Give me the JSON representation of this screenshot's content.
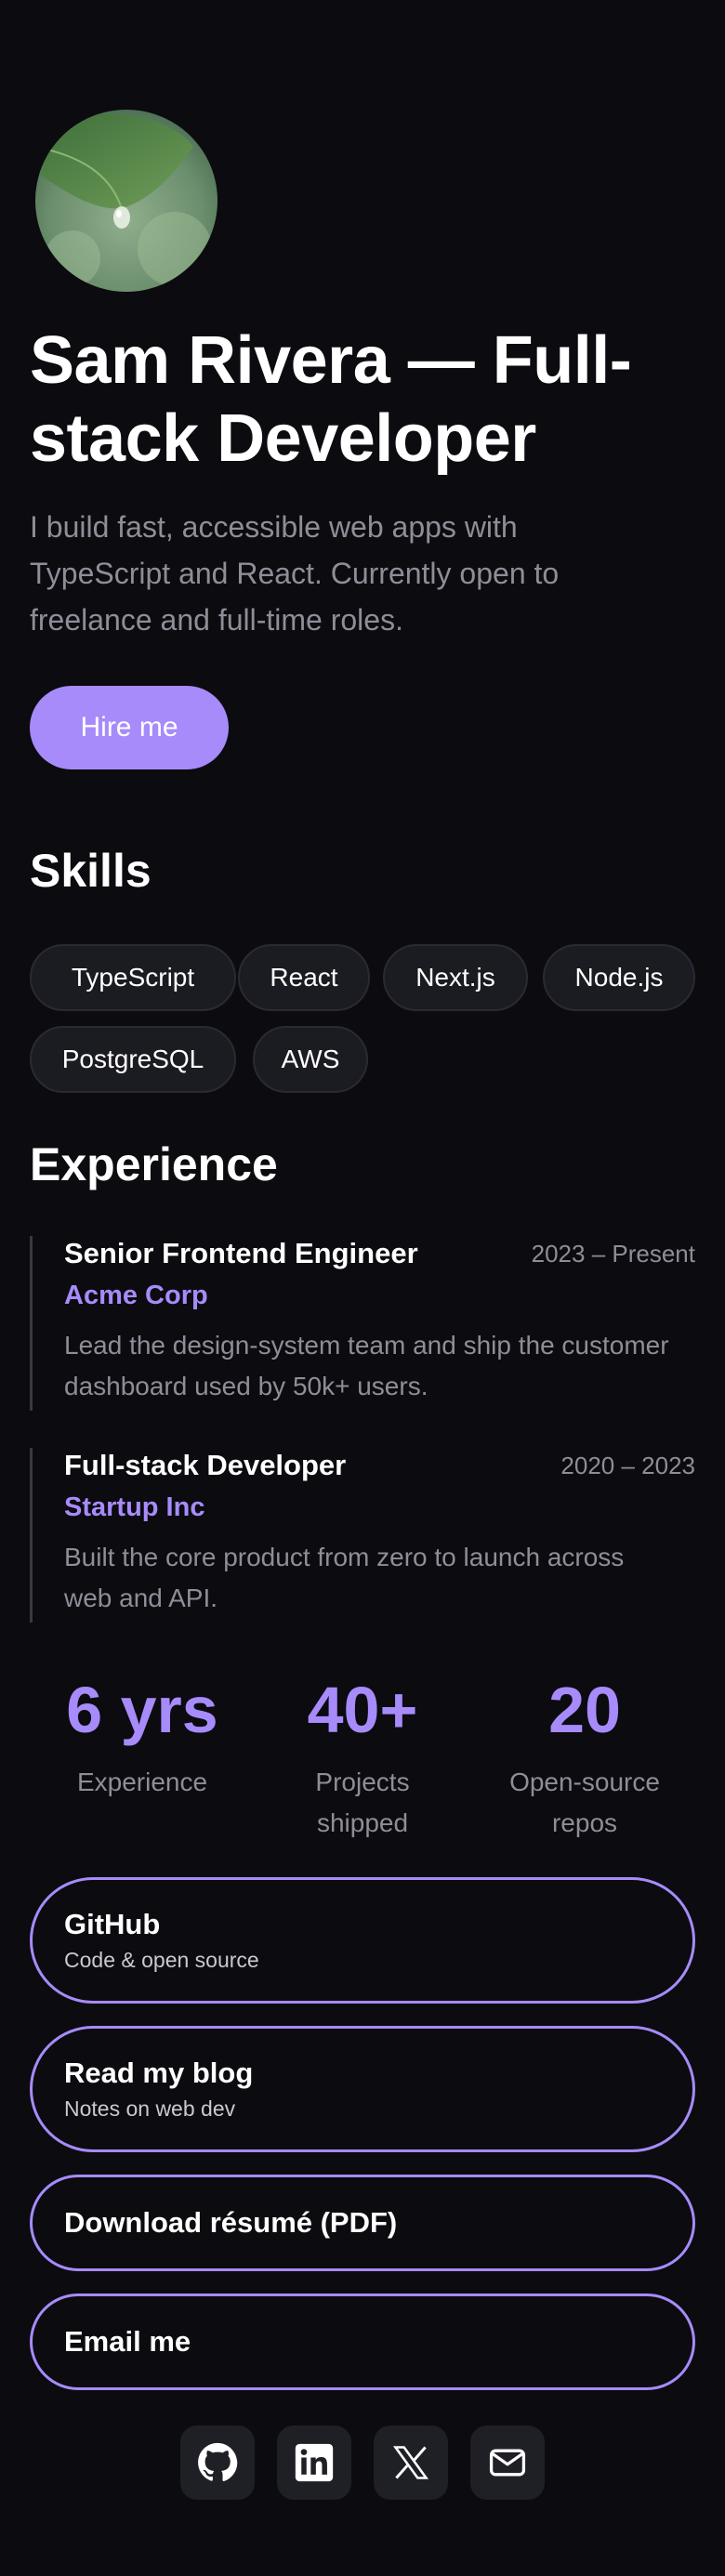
{
  "profile": {
    "title": "Sam Rivera — Full-stack Developer",
    "bio": "I build fast, accessible web apps with TypeScript and React. Currently open to freelance and full-time roles.",
    "hire_label": "Hire me"
  },
  "skills": {
    "title": "Skills",
    "items": [
      "TypeScript",
      "React",
      "Next.js",
      "Node.js",
      "PostgreSQL",
      "AWS"
    ]
  },
  "experience": {
    "title": "Experience",
    "jobs": [
      {
        "title": "Senior Frontend Engineer",
        "company": "Acme Corp",
        "period": "2023 – Present",
        "description": "Lead the design-system team and ship the customer dashboard used by 50k+ users."
      },
      {
        "title": "Full-stack Developer",
        "company": "Startup Inc",
        "period": "2020 – 2023",
        "description": "Built the core product from zero to launch across web and API."
      }
    ]
  },
  "stats": [
    {
      "value": "6 yrs",
      "label": "Experience"
    },
    {
      "value": "40+",
      "label": "Projects shipped"
    },
    {
      "value": "20",
      "label": "Open-source repos"
    }
  ],
  "links": [
    {
      "title": "GitHub",
      "subtitle": "Code & open source"
    },
    {
      "title": "Read my blog",
      "subtitle": "Notes on web dev"
    },
    {
      "title": "Download résumé (PDF)",
      "subtitle": ""
    },
    {
      "title": "Email me",
      "subtitle": ""
    }
  ],
  "social_icons": [
    "github-icon",
    "linkedin-icon",
    "x-icon",
    "mail-icon"
  ],
  "colors": {
    "background": "#0b0b10",
    "accent": "#a78bfa",
    "text": "#ffffff",
    "muted": "#8e8e98",
    "chip_bg": "#1b1b22"
  }
}
